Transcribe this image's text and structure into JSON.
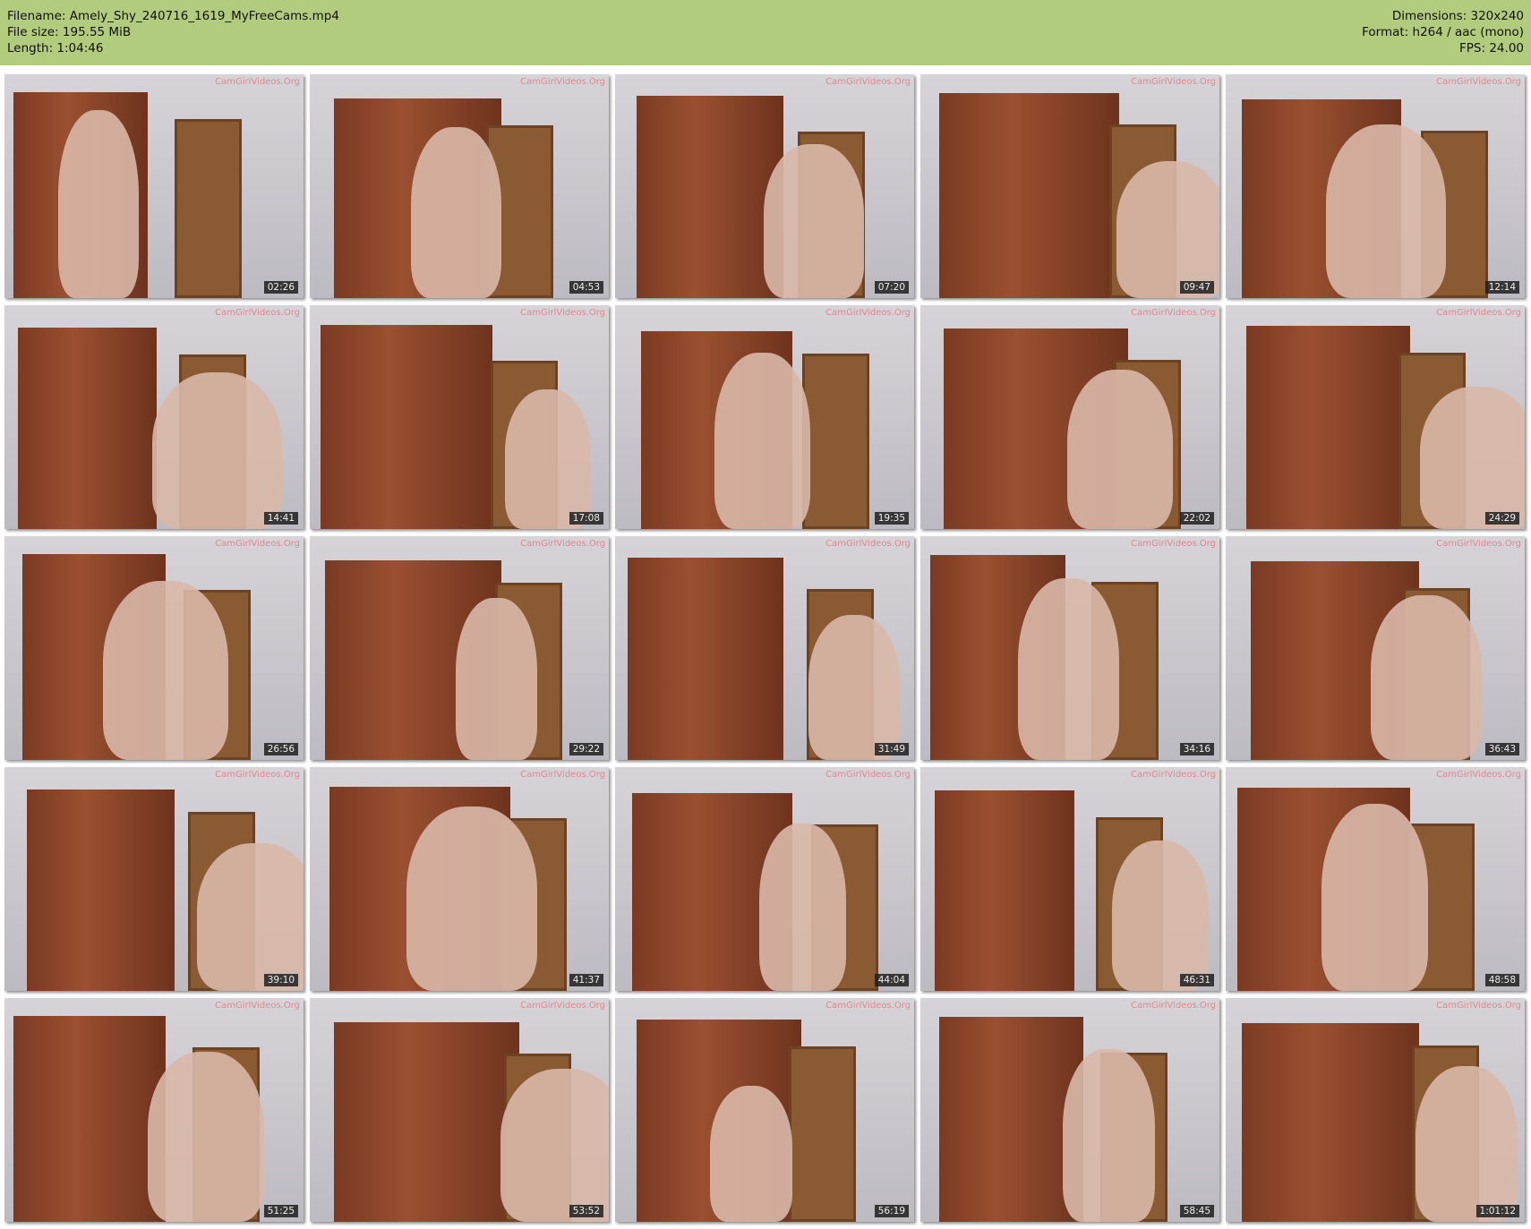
{
  "header": {
    "filename": "Filename: Amely_Shy_240716_1619_MyFreeCams.mp4",
    "filesize": "File size: 195.55 MiB",
    "length": "Length: 1:04:46",
    "dimensions": "Dimensions: 320x240",
    "format": "Format: h264 / aac (mono)",
    "fps": "FPS: 24.00"
  },
  "watermark": "CamGirlVideos.Org",
  "thumbnails": [
    "02:26",
    "04:53",
    "07:20",
    "09:47",
    "12:14",
    "14:41",
    "17:08",
    "19:35",
    "22:02",
    "24:29",
    "26:56",
    "29:22",
    "31:49",
    "34:16",
    "36:43",
    "39:10",
    "41:37",
    "44:04",
    "46:31",
    "48:58",
    "51:25",
    "53:52",
    "56:19",
    "58:45",
    "1:01:12"
  ]
}
